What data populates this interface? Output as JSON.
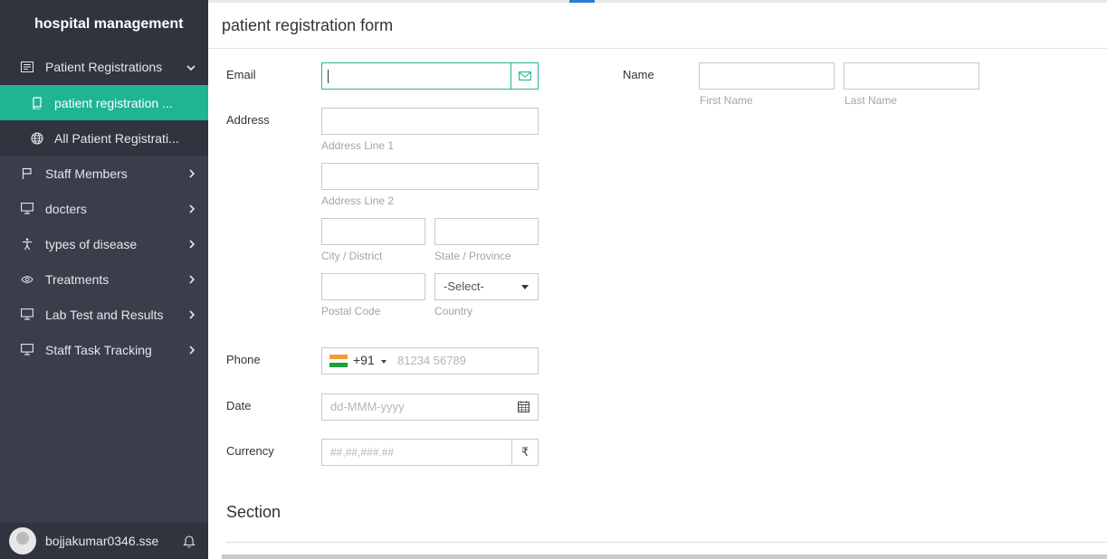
{
  "sidebar": {
    "title": "hospital management",
    "items": [
      {
        "label": "Patient Registrations",
        "icon": "form-icon"
      },
      {
        "label": "patient registration ...",
        "icon": "book-icon"
      },
      {
        "label": "All Patient Registrati...",
        "icon": "globe-icon"
      },
      {
        "label": "Staff Members",
        "icon": "flag-icon"
      },
      {
        "label": "docters",
        "icon": "monitor-icon"
      },
      {
        "label": "types of disease",
        "icon": "accessibility-icon"
      },
      {
        "label": "Treatments",
        "icon": "eye-icon"
      },
      {
        "label": "Lab Test and Results",
        "icon": "monitor-icon"
      },
      {
        "label": "Staff Task Tracking",
        "icon": "monitor-icon"
      }
    ],
    "user": "bojjakumar0346.sse"
  },
  "header": {
    "title": "patient registration form"
  },
  "form": {
    "email_label": "Email",
    "email_value": "",
    "name_label": "Name",
    "first_name_hint": "First Name",
    "last_name_hint": "Last Name",
    "address_label": "Address",
    "address_line1_hint": "Address Line 1",
    "address_line2_hint": "Address Line 2",
    "city_hint": "City / District",
    "state_hint": "State / Province",
    "postal_hint": "Postal Code",
    "country_hint": "Country",
    "country_select": "-Select-",
    "phone_label": "Phone",
    "phone_code": "+91",
    "phone_placeholder": "81234 56789",
    "date_label": "Date",
    "date_placeholder": "dd-MMM-yyyy",
    "currency_label": "Currency",
    "currency_placeholder": "##,##,###.##",
    "currency_symbol": "₹",
    "section_title": "Section"
  },
  "colors": {
    "accent": "#1fb593",
    "sidebar_bg": "#3a3d4a"
  }
}
